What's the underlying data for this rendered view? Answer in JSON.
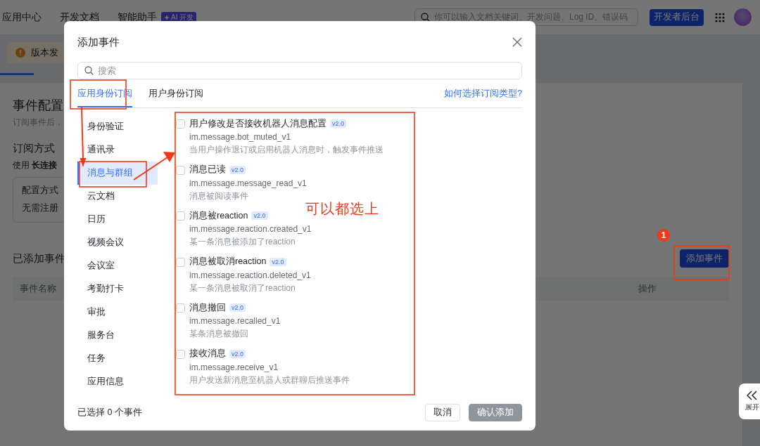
{
  "top_nav": {
    "items": [
      {
        "label": "应用中心"
      },
      {
        "label": "开发文档"
      },
      {
        "label": "智能助手"
      }
    ],
    "ai_badge": "AI 开发",
    "search": {
      "placeholder": "你可以输入文档关键词、开发问题、Log ID、错误码"
    },
    "console_button": "开发者后台"
  },
  "banner": {
    "text": "版本发"
  },
  "page": {
    "title": "事件配置",
    "subtitle": "订阅事件后，",
    "subscribe_title": "订阅方式",
    "subscribe_text": "使用 **长连接**",
    "config_label": "配置方式",
    "config_value": "无需注册",
    "added_title": "已添加事件",
    "columns": [
      "事件名称",
      "操作"
    ],
    "add_button": "添加事件",
    "expand": "展开"
  },
  "dialog": {
    "title": "添加事件",
    "search": {
      "placeholder": "搜索"
    },
    "tabs": [
      {
        "label": "应用身份订阅",
        "selected": true
      },
      {
        "label": "用户身份订阅",
        "selected": false
      }
    ],
    "help_link": "如何选择订阅类型?",
    "categories": [
      {
        "label": "身份验证",
        "selected": false
      },
      {
        "label": "通讯录",
        "selected": false
      },
      {
        "label": "消息与群组",
        "selected": true
      },
      {
        "label": "云文档",
        "selected": false
      },
      {
        "label": "日历",
        "selected": false
      },
      {
        "label": "视频会议",
        "selected": false
      },
      {
        "label": "会议室",
        "selected": false
      },
      {
        "label": "考勤打卡",
        "selected": false
      },
      {
        "label": "审批",
        "selected": false
      },
      {
        "label": "服务台",
        "selected": false
      },
      {
        "label": "任务",
        "selected": false
      },
      {
        "label": "应用信息",
        "selected": false
      }
    ],
    "events": [
      {
        "title": "用户修改是否接收机器人消息配置",
        "version": "v2.0",
        "code": "im.message.bot_muted_v1",
        "description": "当用户操作退订或启用机器人消息时，触发事件推送",
        "checked": false
      },
      {
        "title": "消息已读",
        "version": "v2.0",
        "code": "im.message.message_read_v1",
        "description": "消息被阅读事件",
        "checked": false
      },
      {
        "title": "消息被reaction",
        "version": "v2.0",
        "code": "im.message.reaction.created_v1",
        "description": "某一条消息被添加了reaction",
        "checked": false
      },
      {
        "title": "消息被取消reaction",
        "version": "v2.0",
        "code": "im.message.reaction.deleted_v1",
        "description": "某一条消息被取消了reaction",
        "checked": false
      },
      {
        "title": "消息撤回",
        "version": "v2.0",
        "code": "im.message.recalled_v1",
        "description": "某条消息被撤回",
        "checked": false
      },
      {
        "title": "接收消息",
        "version": "v2.0",
        "code": "im.message.receive_v1",
        "description": "用户发送新消息至机器人或群聊后推送事件",
        "checked": false
      }
    ],
    "selection_count": "已选择 0 个事件",
    "buttons": [
      {
        "label": "取消",
        "kind": "secondary",
        "disabled": false
      },
      {
        "label": "确认添加",
        "kind": "primary",
        "disabled": true
      }
    ]
  },
  "annotations": {
    "note": "可以都选上",
    "step_badge": "1"
  }
}
